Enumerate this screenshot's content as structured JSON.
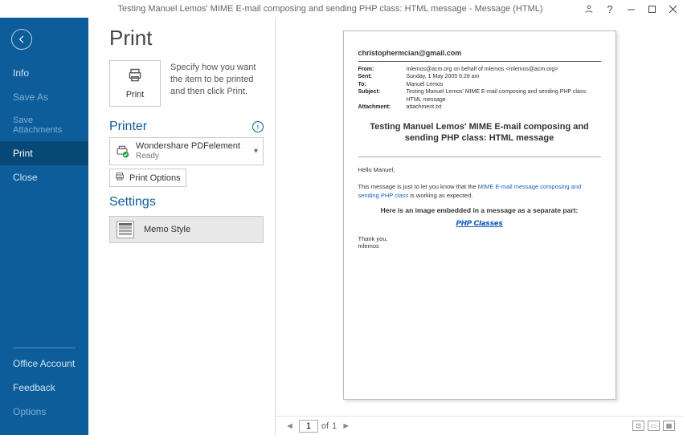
{
  "titlebar": {
    "text": "Testing Manuel Lemos' MIME E-mail composing and sending PHP class: HTML message  -  Message (HTML)"
  },
  "sidebar": {
    "items": [
      {
        "label": "Info",
        "dim": false
      },
      {
        "label": "Save As",
        "dim": true
      },
      {
        "label": "Save Attachments",
        "dim": true
      },
      {
        "label": "Print",
        "dim": false,
        "selected": true
      },
      {
        "label": "Close",
        "dim": false
      }
    ],
    "bottom": [
      {
        "label": "Office Account",
        "dim": false
      },
      {
        "label": "Feedback",
        "dim": false
      },
      {
        "label": "Options",
        "dim": true
      }
    ]
  },
  "controls": {
    "page_title": "Print",
    "print_tile_label": "Print",
    "print_desc": "Specify how you want the item to be printed and then click Print.",
    "printer_heading": "Printer",
    "printer": {
      "name": "Wondershare PDFelement",
      "status": "Ready"
    },
    "print_options_label": "Print Options",
    "settings_heading": "Settings",
    "style_label": "Memo Style"
  },
  "preview": {
    "address": "christophermcian@gmail.com",
    "headers": {
      "from_k": "From:",
      "from_v": "mlemos@acm.org on behalf of mlemos <mlemos@acm.org>",
      "sent_k": "Sent:",
      "sent_v": "Sunday, 1 May 2005 6:28 am",
      "to_k": "To:",
      "to_v": "Manuel Lemos",
      "subject_k": "Subject:",
      "subject_v": "Testing Manuel Lemos' MIME E-mail composing and sending PHP class: HTML message",
      "attach_k": "Attachment:",
      "attach_v": "attachment.txt"
    },
    "title": "Testing Manuel Lemos' MIME E-mail composing and sending PHP class: HTML message",
    "greeting": "Hello Manuel,",
    "body_pre": "This message is just to let you know that the ",
    "body_link": "MIME E-mail message composing and sending PHP class",
    "body_post": " is working as expected.",
    "subhead": "Here is an image embedded in a message as a separate part:",
    "logo_text": "PHP Classes",
    "thanks": "Thank you,",
    "sig": "mlemos"
  },
  "pager": {
    "current": "1",
    "of_label": "of",
    "total": "1"
  }
}
